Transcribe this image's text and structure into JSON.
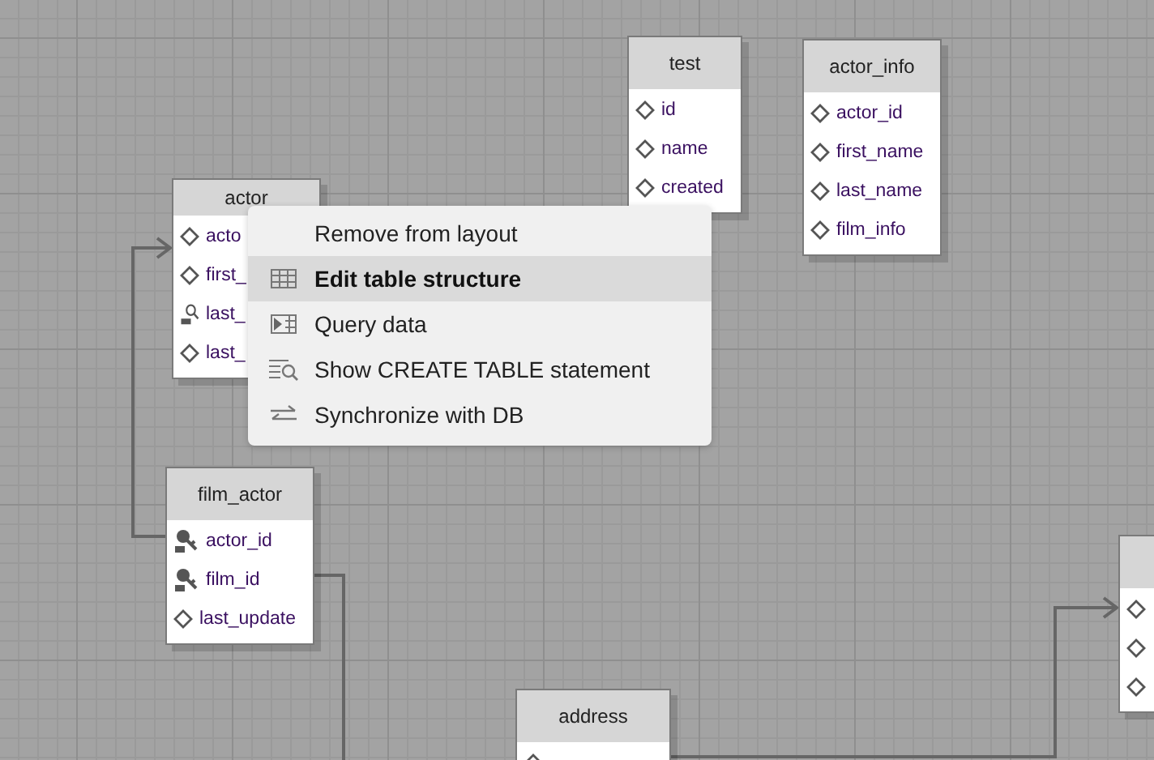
{
  "tables": [
    {
      "name": "test",
      "columns": [
        {
          "name": "id",
          "kind": "attribute"
        },
        {
          "name": "name",
          "kind": "attribute"
        },
        {
          "name": "created",
          "kind": "attribute"
        }
      ]
    },
    {
      "name": "actor_info",
      "columns": [
        {
          "name": "actor_id",
          "kind": "attribute"
        },
        {
          "name": "first_name",
          "kind": "attribute"
        },
        {
          "name": "last_name",
          "kind": "attribute"
        },
        {
          "name": "film_info",
          "kind": "attribute"
        }
      ]
    },
    {
      "name": "actor",
      "columns": [
        {
          "name": "acto",
          "kind": "attribute"
        },
        {
          "name": "first_",
          "kind": "attribute"
        },
        {
          "name": "last_",
          "kind": "index"
        },
        {
          "name": "last_",
          "kind": "attribute"
        }
      ]
    },
    {
      "name": "film_actor",
      "columns": [
        {
          "name": "actor_id",
          "kind": "foreign-key"
        },
        {
          "name": "film_id",
          "kind": "foreign-key"
        },
        {
          "name": "last_update",
          "kind": "attribute"
        }
      ]
    },
    {
      "name": "address",
      "columns": [
        {
          "kind": "attribute"
        }
      ]
    },
    {
      "columns": [
        {
          "kind": "attribute"
        },
        {
          "kind": "attribute"
        },
        {
          "kind": "attribute"
        }
      ]
    }
  ],
  "context_menu": {
    "items": [
      {
        "label": "Remove from layout",
        "selected": false
      },
      {
        "label": "Edit table structure",
        "selected": true
      },
      {
        "label": "Query data",
        "selected": false
      },
      {
        "label": "Show CREATE TABLE statement",
        "selected": false
      },
      {
        "label": "Synchronize with DB",
        "selected": false
      }
    ]
  }
}
